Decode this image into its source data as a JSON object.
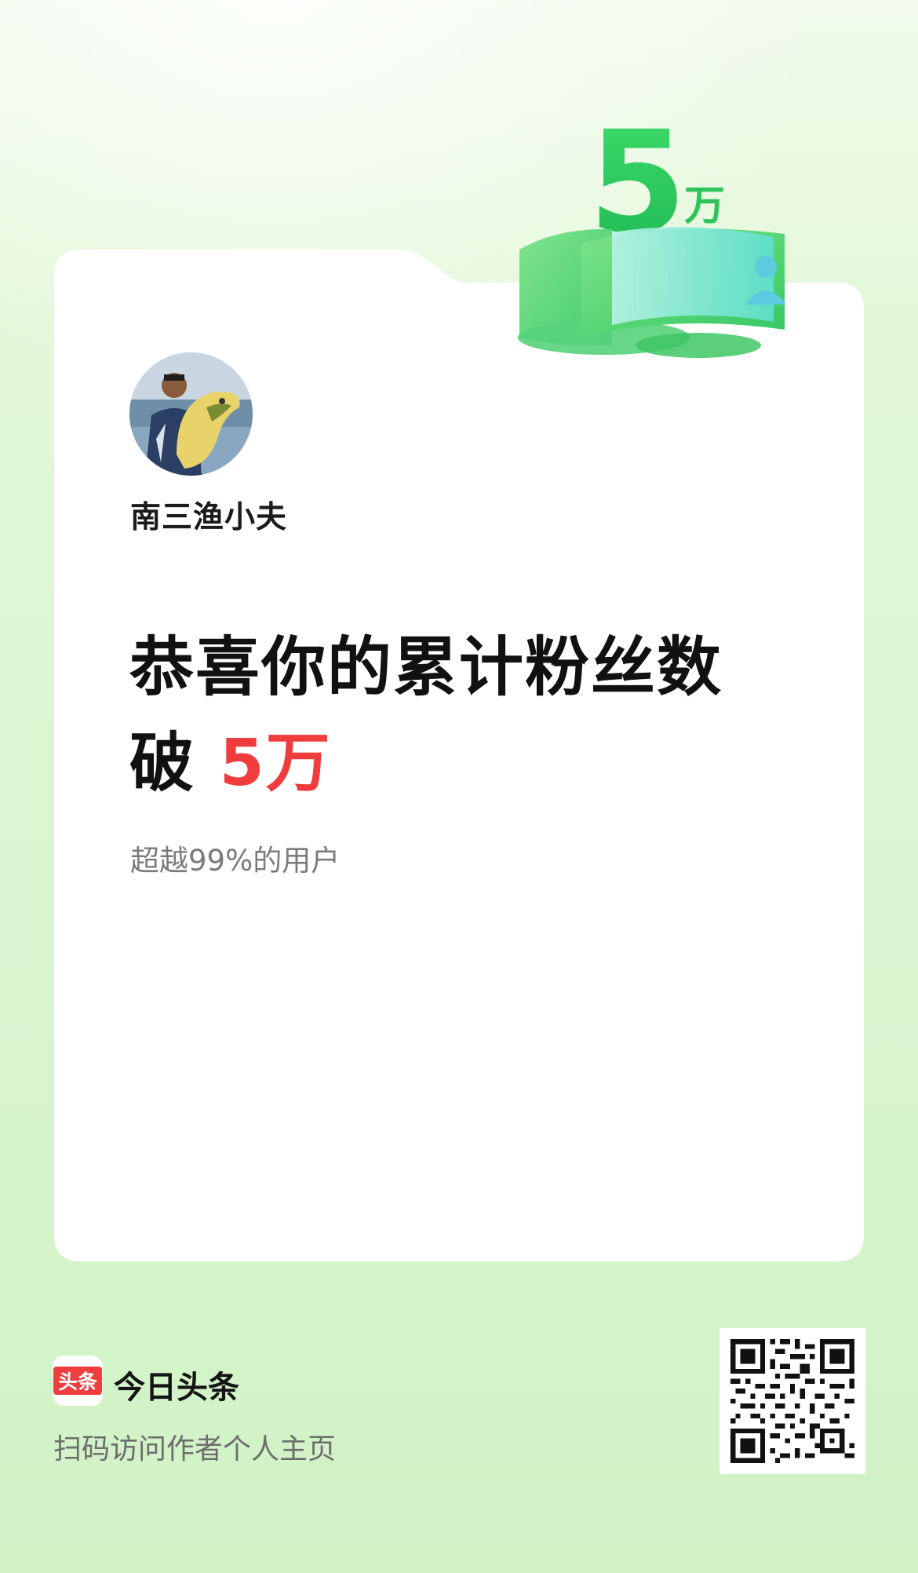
{
  "author": {
    "name": "南三渔小夫"
  },
  "headline": {
    "line1": "恭喜你的累计粉丝数",
    "line2_prefix": "破 ",
    "line2_highlight": "5万"
  },
  "subline": "超越99%的用户",
  "badge": {
    "number": "5",
    "unit": "万"
  },
  "footer": {
    "app_logo_text": "头条",
    "app_name": "今日头条",
    "scan_hint": "扫码访问作者个人主页"
  },
  "colors": {
    "accent_red": "#ef3c3c",
    "accent_green": "#3fd474",
    "background_green": "#d9f5cf"
  },
  "icons": [
    "user-icon",
    "qr-code"
  ]
}
